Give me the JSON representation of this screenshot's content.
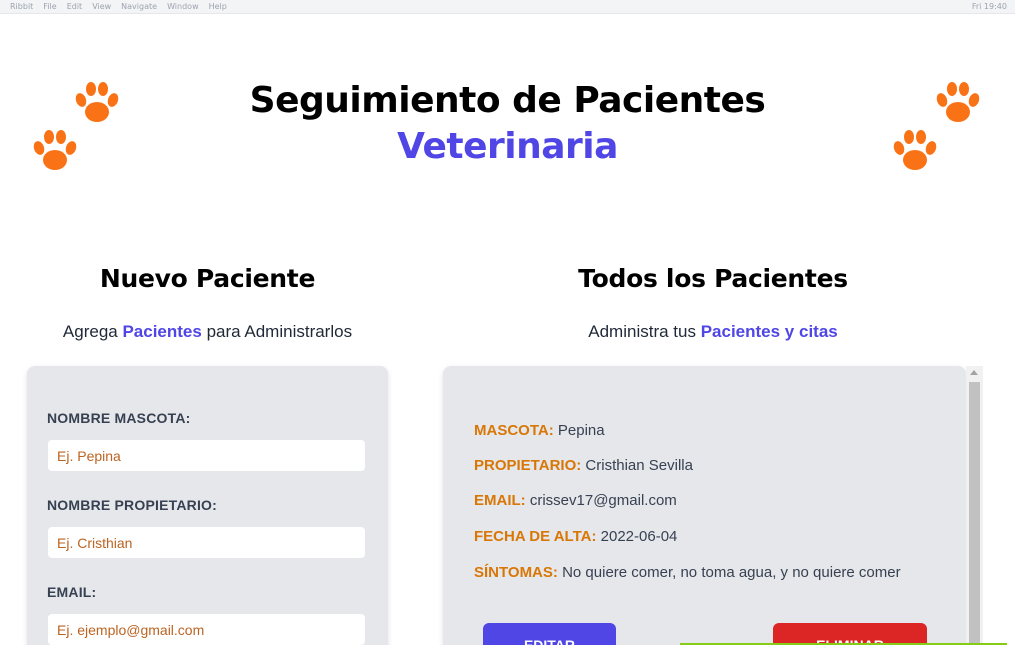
{
  "menubar": {
    "items": [
      "Ribbit",
      "File",
      "Edit",
      "View",
      "Navigate",
      "Window",
      "Help"
    ],
    "clock": "Fri 19:40"
  },
  "header": {
    "title": "Seguimiento de Pacientes",
    "title_accent": "Veterinaria"
  },
  "form_section": {
    "title": "Nuevo Paciente",
    "subtitle_prefix": "Agrega ",
    "subtitle_highlight": "Pacientes",
    "subtitle_suffix": " para Administrarlos",
    "fields": [
      {
        "label": "NOMBRE MASCOTA:",
        "placeholder": "Ej. Pepina",
        "value": ""
      },
      {
        "label": "NOMBRE PROPIETARIO:",
        "placeholder": "Ej. Cristhian",
        "value": ""
      },
      {
        "label": "EMAIL:",
        "placeholder": "Ej. ejemplo@gmail.com",
        "value": ""
      }
    ]
  },
  "list_section": {
    "title": "Todos los Pacientes",
    "subtitle_prefix": "Administra tus ",
    "subtitle_highlight": "Pacientes y citas",
    "patient": {
      "mascota_label": "MASCOTA:",
      "mascota": "Pepina",
      "propietario_label": "PROPIETARIO:",
      "propietario": "Cristhian Sevilla",
      "email_label": "EMAIL:",
      "email": "crissev17@gmail.com",
      "fecha_label": "FECHA DE ALTA:",
      "fecha": "2022-06-04",
      "sintomas_label": "SÍNTOMAS:",
      "sintomas": "No quiere comer, no toma agua, y no quiere comer"
    },
    "edit_label": "EDITAR",
    "delete_label": "ELIMINAR"
  },
  "colors": {
    "accent": "#4f46e5",
    "paw": "#f97316",
    "field_key": "#d97706",
    "danger": "#dc2626",
    "card": "#e5e7eb"
  },
  "icons": [
    "paw-icon"
  ]
}
